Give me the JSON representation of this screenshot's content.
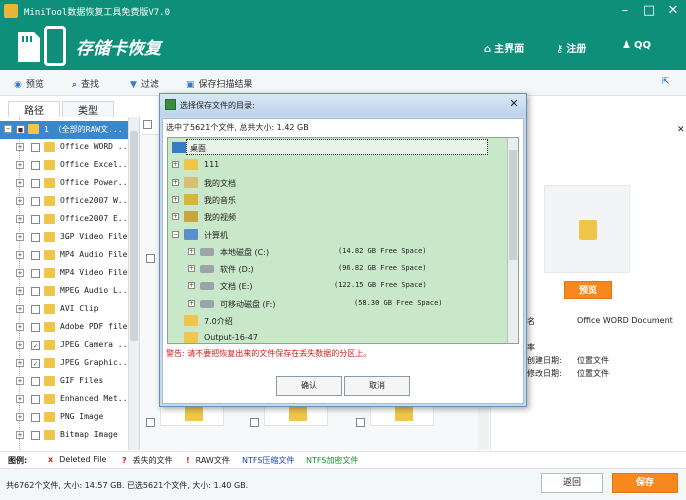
{
  "titlebar": {
    "title": "MiniTool数据恢复工具免费版V7.0"
  },
  "header": {
    "title": "存储卡恢复",
    "links": [
      {
        "label": "主界面",
        "icon": "home-icon"
      },
      {
        "label": "注册",
        "icon": "key-icon"
      },
      {
        "label": "QQ",
        "icon": "qq-icon"
      }
    ]
  },
  "toolbar": {
    "items": [
      {
        "label": "预览",
        "icon": "eye-icon"
      },
      {
        "label": "查找",
        "icon": "search-icon"
      },
      {
        "label": "过滤",
        "icon": "filter-icon"
      },
      {
        "label": "保存扫描结果",
        "icon": "save-icon"
      }
    ]
  },
  "tabs": {
    "path": "路径",
    "type": "类型"
  },
  "tree": {
    "root": "1 （全部的RAW文...",
    "items": [
      {
        "label": "Office WORD ...",
        "checked": false
      },
      {
        "label": "Office Excel...",
        "checked": false
      },
      {
        "label": "Office Power...",
        "checked": false
      },
      {
        "label": "Office2007 W...",
        "checked": false
      },
      {
        "label": "Office2007 E...",
        "checked": false
      },
      {
        "label": "3GP Video File",
        "checked": false
      },
      {
        "label": "MP4 Audio File",
        "checked": false
      },
      {
        "label": "MP4 Video File",
        "checked": false
      },
      {
        "label": "MPEG Audio L...",
        "checked": false
      },
      {
        "label": "AVI Clip",
        "checked": false
      },
      {
        "label": "Adobe PDF file",
        "checked": false
      },
      {
        "label": "JPEG Camera ...",
        "checked": true
      },
      {
        "label": "JPEG Graphic...",
        "checked": true
      },
      {
        "label": "GIF Files",
        "checked": false
      },
      {
        "label": "Enhanced Met...",
        "checked": false
      },
      {
        "label": "PNG Image",
        "checked": false
      },
      {
        "label": "Bitmap Image",
        "checked": false
      }
    ]
  },
  "right_panel": {
    "preview_button": "预览",
    "info": [
      {
        "key": "件名",
        "value": "Office WORD Document"
      },
      {
        "key": "小",
        "value": ""
      },
      {
        "key": "辨率",
        "value": ""
      },
      {
        "key": "件创建日期:",
        "value": "位置文件"
      },
      {
        "key": "件修改日期:",
        "value": "位置文件"
      }
    ]
  },
  "legend": {
    "label": "图例:",
    "items": [
      {
        "mark": "x",
        "text": "Deleted File",
        "color": "#d21b1b"
      },
      {
        "mark": "?",
        "text": "丢失的文件",
        "color": "#d21b1b"
      },
      {
        "mark": "!",
        "text": "RAW文件",
        "color": "#d21b1b"
      },
      {
        "mark": "",
        "text": "NTFS压缩文件",
        "color": "#1a3fbf"
      },
      {
        "mark": "",
        "text": "NTFS加密文件",
        "color": "#1a8f2a"
      }
    ]
  },
  "status": {
    "text": "共6762个文件, 大小: 14.57 GB.  已选5621个文件, 大小: 1.40 GB.",
    "back": "返回",
    "save": "保存"
  },
  "dialog": {
    "title": "选择保存文件的目录:",
    "summary": "选中了5621个文件, 总共大小: 1.42 GB",
    "tree": [
      {
        "label": "桌面",
        "icon": "desktop-icon",
        "size": ""
      },
      {
        "label": "111",
        "icon": "folder-icon",
        "size": ""
      },
      {
        "label": "我的文档",
        "icon": "documents-icon",
        "size": ""
      },
      {
        "label": "我的音乐",
        "icon": "music-icon",
        "size": ""
      },
      {
        "label": "我的视频",
        "icon": "video-icon",
        "size": ""
      },
      {
        "label": "计算机",
        "icon": "computer-icon",
        "size": ""
      },
      {
        "label": "本地磁盘 (C:)",
        "icon": "drive-icon",
        "size": "(14.82 GB Free Space)"
      },
      {
        "label": "软件 (D:)",
        "icon": "drive-icon",
        "size": "(96.82 GB Free Space)"
      },
      {
        "label": "文档 (E:)",
        "icon": "drive-icon",
        "size": "(122.15 GB Free Space)"
      },
      {
        "label": "可移动磁盘 (F:)",
        "icon": "drive-icon",
        "size": "(58.30 GB Free Space)"
      },
      {
        "label": "7.0介绍",
        "icon": "folder-icon",
        "size": ""
      },
      {
        "label": "Output-16-47",
        "icon": "folder-icon",
        "size": ""
      }
    ],
    "warning": "警告: 请不要把恢复出来的文件保存在丢失数据的分区上。",
    "ok": "确认",
    "cancel": "取消"
  },
  "colors": {
    "brand": "#0e8f7a",
    "accent": "#f7881f",
    "selection": "#3b87c9"
  }
}
